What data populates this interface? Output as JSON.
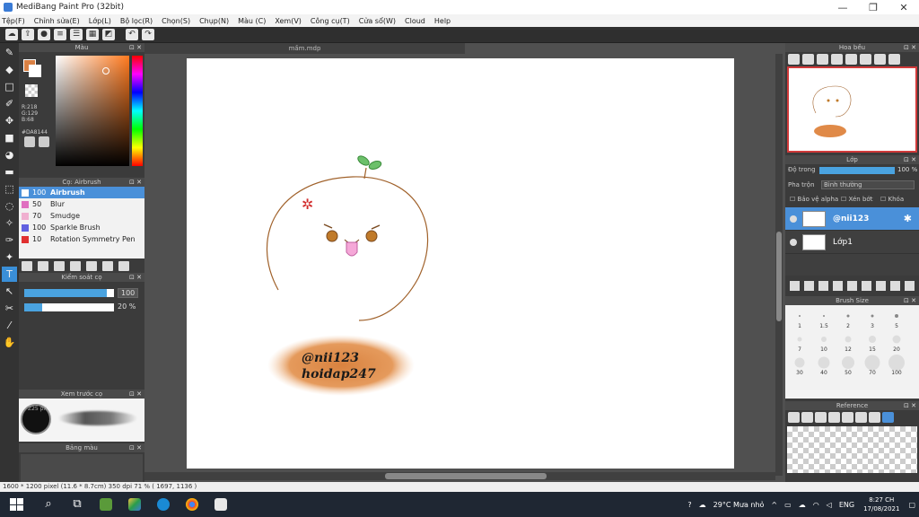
{
  "window": {
    "title": "MediBang Paint Pro (32bit)",
    "min": "—",
    "max": "❐",
    "close": "✕"
  },
  "menu": [
    "Tệp(F)",
    "Chỉnh sửa(E)",
    "Lớp(L)",
    "Bộ lọc(R)",
    "Chọn(S)",
    "Chụp(N)",
    "Màu (C)",
    "Xem(V)",
    "Công cụ(T)",
    "Cửa sổ(W)",
    "Cloud",
    "Help"
  ],
  "toolbar": {
    "undo": "↶",
    "redo": "↷"
  },
  "color_panel": {
    "title": "Màu",
    "r": "R:218",
    "g": "G:129",
    "b": "B:68",
    "hex": "#DA8144",
    "color": "#DA8144"
  },
  "brush_panel": {
    "title": "Cọ: Airbrush",
    "brushes": [
      {
        "size": "100",
        "name": "Airbrush",
        "color": "#4a90d9"
      },
      {
        "size": "50",
        "name": "Blur",
        "color": "#e070c0"
      },
      {
        "size": "70",
        "name": "Smudge",
        "color": "#f0b0d0"
      },
      {
        "size": "100",
        "name": "Sparkle Brush",
        "color": "#6060e0"
      },
      {
        "size": "10",
        "name": "Rotation Symmetry Pen",
        "color": "#e03030"
      }
    ]
  },
  "brush_control": {
    "title": "Kiểm soát cọ",
    "size_value": "100",
    "size_level": 0.92,
    "opacity_value": "20 %",
    "opacity_level": 0.2
  },
  "brush_preview": {
    "title": "Xem trước cọ",
    "size_label": "Z25 px"
  },
  "palette": {
    "title": "Bảng màu"
  },
  "document": {
    "tab_title": "mầm.mdp",
    "signature_line1": "@nii123",
    "signature_line2": "hoidap247"
  },
  "navigator": {
    "title": "Hoa bều"
  },
  "layer_panel": {
    "title": "Lớp",
    "opacity_label": "Độ trong",
    "opacity_value": "100 %",
    "blend_label": "Pha trộn",
    "blend_value": "Bình thường",
    "protect_alpha": "Bảo vệ alpha",
    "clipping": "Xén bớt",
    "lock": "Khóa",
    "layers": [
      {
        "name": "@nii123",
        "selected": true
      },
      {
        "name": "Lớp1",
        "selected": false
      }
    ]
  },
  "brush_size_panel": {
    "title": "Brush Size",
    "sizes": [
      "1",
      "1.5",
      "2",
      "3",
      "5",
      "7",
      "10",
      "12",
      "15",
      "20",
      "30",
      "40",
      "50",
      "70",
      "100"
    ]
  },
  "reference": {
    "title": "Reference"
  },
  "status": {
    "text": "1600 * 1200 pixel   (11.6 * 8.7cm)   350 dpi   71 %   ( 1697, 1136 )"
  },
  "taskbar": {
    "weather": "29°C  Mưa nhỏ",
    "lang": "ENG",
    "time": "8:27 CH",
    "date": "17/08/2021"
  }
}
